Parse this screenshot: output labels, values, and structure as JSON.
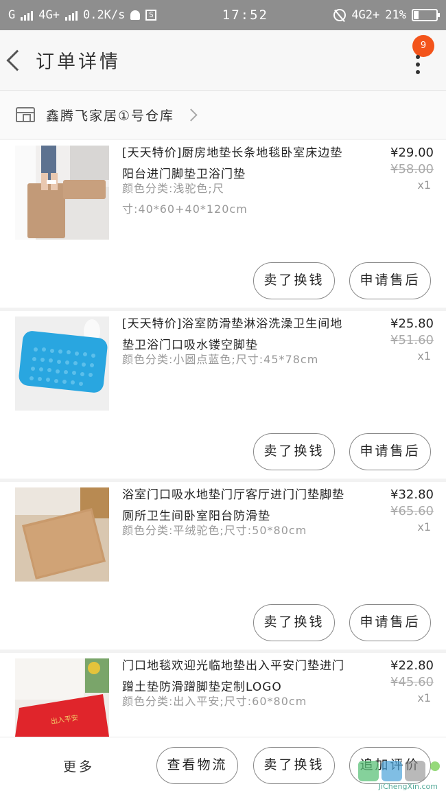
{
  "status_bar": {
    "carrier_left": "G",
    "network_left": "4G+",
    "speed": "0.2K/s",
    "sbox": "S",
    "time": "17:52",
    "network_right": "4G2+",
    "battery_pct": "21%",
    "battery_level": 0.21
  },
  "header": {
    "title": "订单详情",
    "badge": "9"
  },
  "shop": {
    "name": "鑫腾飞家居①号仓库"
  },
  "items": [
    {
      "title": "[天天特价]厨房地垫长条地毯卧室床边垫阳台进门脚垫卫浴门垫",
      "spec": "颜色分类:浅驼色;尺寸:40*60+40*120cm",
      "price": "¥29.00",
      "orig_price": "¥58.00",
      "qty": "x1",
      "btn_return": "卖了换钱",
      "btn_after": "申请售后"
    },
    {
      "title": "[天天特价]浴室防滑垫淋浴洗澡卫生间地垫卫浴门口吸水镂空脚垫",
      "spec": "颜色分类:小圆点蓝色;尺寸:45*78cm",
      "price": "¥25.80",
      "orig_price": "¥51.60",
      "qty": "x1",
      "btn_return": "卖了换钱",
      "btn_after": "申请售后"
    },
    {
      "title": "浴室门口吸水地垫门厅客厅进门门垫脚垫厕所卫生间卧室阳台防滑垫",
      "spec": "颜色分类:平绒驼色;尺寸:50*80cm",
      "price": "¥32.80",
      "orig_price": "¥65.60",
      "qty": "x1",
      "btn_return": "卖了换钱",
      "btn_after": "申请售后"
    },
    {
      "title": "门口地毯欢迎光临地垫出入平安门垫进门蹭土垫防滑蹭脚垫定制LOGO",
      "spec": "颜色分类:出入平安;尺寸:60*80cm",
      "price": "¥22.80",
      "orig_price": "¥45.60",
      "qty": "x1",
      "mat_text": "出入平安"
    }
  ],
  "bottom_bar": {
    "more": "更多",
    "logistics": "查看物流",
    "return": "卖了换钱",
    "review": "追加评价"
  },
  "watermark": {
    "text": "JiChengXin.com",
    "logo": "集城信"
  },
  "colors": {
    "accent": "#f3541b",
    "mat_blue": "#29a6e0",
    "mat_red": "#e0252b",
    "mat_tan": "#c99a6c"
  }
}
